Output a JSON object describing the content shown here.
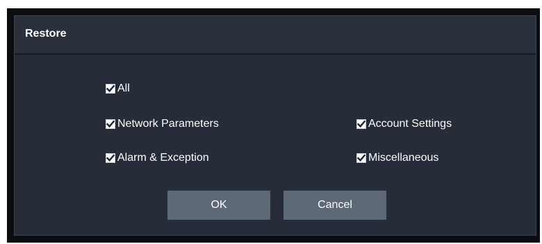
{
  "dialog": {
    "title": "Restore"
  },
  "options": {
    "all": {
      "label": "All",
      "checked": true
    },
    "network_parameters": {
      "label": "Network Parameters",
      "checked": true
    },
    "account_settings": {
      "label": "Account Settings",
      "checked": true
    },
    "alarm_exception": {
      "label": "Alarm & Exception",
      "checked": true
    },
    "miscellaneous": {
      "label": "Miscellaneous",
      "checked": true
    }
  },
  "buttons": {
    "ok_label": "OK",
    "cancel_label": "Cancel"
  },
  "colors": {
    "dialog_bg": "#262d38",
    "button_bg": "#5e6978",
    "text": "#ffffff",
    "checkmark": "#1e2530"
  },
  "icons": {
    "checkbox": "checkmark-icon"
  }
}
